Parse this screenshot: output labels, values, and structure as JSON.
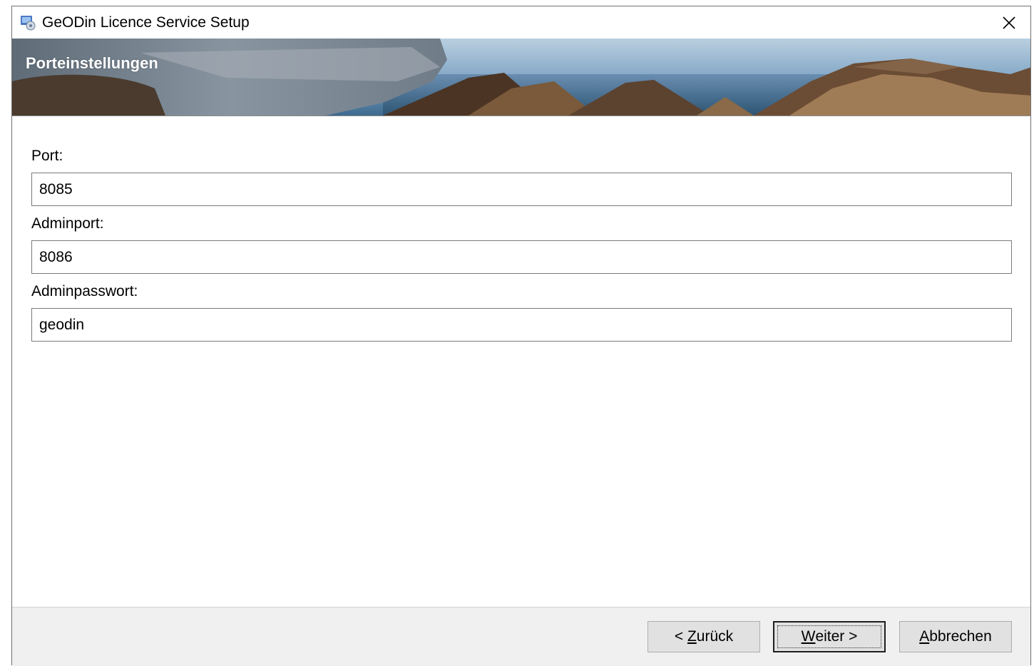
{
  "window": {
    "title": "GeODin Licence Service Setup"
  },
  "banner": {
    "title": "Porteinstellungen"
  },
  "form": {
    "port": {
      "label": "Port:",
      "value": "8085"
    },
    "adminport": {
      "label": "Adminport:",
      "value": "8086"
    },
    "adminpassword": {
      "label": "Adminpasswort:",
      "value": "geodin"
    }
  },
  "buttons": {
    "back": {
      "prefix": "< ",
      "accel": "Z",
      "rest": "urück"
    },
    "next": {
      "accel": "W",
      "rest": "eiter >"
    },
    "cancel": {
      "accel": "A",
      "rest": "bbrechen"
    }
  },
  "icons": {
    "app": "installer-icon",
    "close": "close-icon"
  }
}
